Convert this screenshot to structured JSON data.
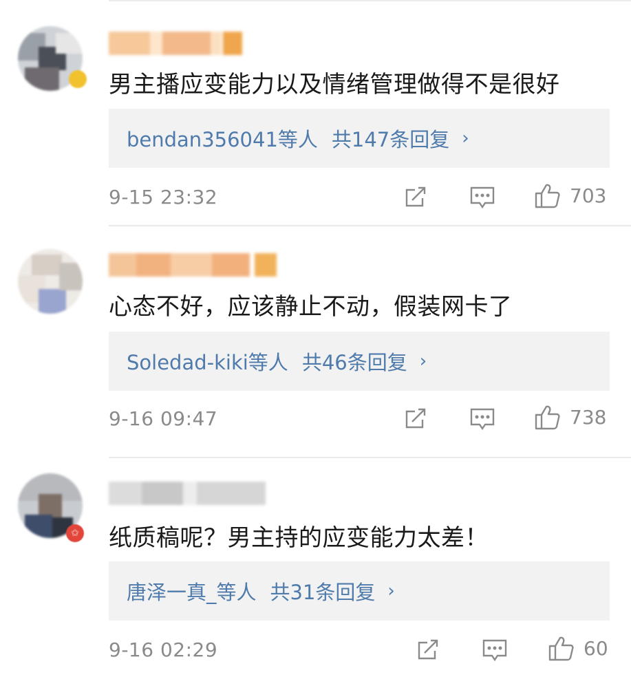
{
  "comments": [
    {
      "text": "男主播应变能力以及情绪管理做得不是很好",
      "reply_users": "bendan356041等人",
      "reply_count": "共147条回复",
      "reply_chevron": "›",
      "time": "9-15 23:32",
      "likes": "703"
    },
    {
      "text": "心态不好，应该静止不动，假装网卡了",
      "reply_users": "Soledad-kiki等人",
      "reply_count": "共46条回复",
      "reply_chevron": "›",
      "time": "9-16 09:47",
      "likes": "738"
    },
    {
      "text": "纸质稿呢？男主持的应变能力太差！",
      "reply_users": "唐泽一真_等人",
      "reply_count": "共31条回复",
      "reply_chevron": "›",
      "time": "9-16 02:29",
      "likes": "60"
    }
  ],
  "icons": {
    "repost": "repost-icon",
    "comment": "comment-icon",
    "like": "like-icon",
    "badge_gold": "gold-badge-icon",
    "badge_red": "red-star-badge-icon"
  },
  "colors": {
    "link": "#4f7bac",
    "reply_bg": "#f2f2f2",
    "meta": "#8a8a8a",
    "text": "#1a1a1a"
  }
}
